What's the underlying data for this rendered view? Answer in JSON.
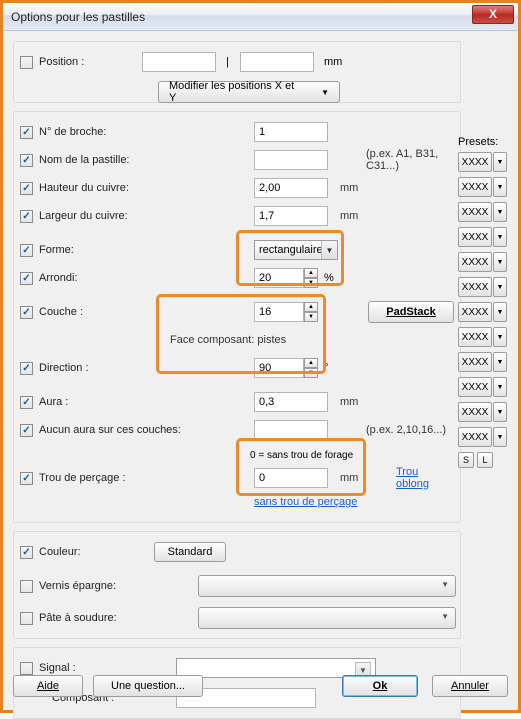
{
  "title": "Options pour les pastilles",
  "close_glyph": "X",
  "position": {
    "checkbox_label": "Position :",
    "x": "",
    "sep": "|",
    "y": "",
    "unit": "mm",
    "modify_button": "Modifier les positions X et Y"
  },
  "fields": {
    "pin_number": {
      "label": "N° de broche:",
      "value": "1"
    },
    "pad_name": {
      "label": "Nom de la pastille:",
      "value": "",
      "hint": "(p.ex. A1, B31, C31...)"
    },
    "copper_height": {
      "label": "Hauteur du cuivre:",
      "value": "2,00",
      "unit": "mm"
    },
    "copper_width": {
      "label": "Largeur du cuivre:",
      "value": "1,7",
      "unit": "mm"
    },
    "shape": {
      "label": "Forme:",
      "value": "rectangulaire"
    },
    "rounded": {
      "label": "Arrondi:",
      "value": "20",
      "unit": "%"
    },
    "layer": {
      "label": "Couche :",
      "value": "16"
    },
    "layer_note": "Face composant: pistes",
    "direction": {
      "label": "Direction :",
      "value": "90",
      "unit": "°"
    },
    "aura": {
      "label": "Aura :",
      "value": "0,3",
      "unit": "mm"
    },
    "no_aura": {
      "label": "Aucun aura sur ces couches:",
      "value": "",
      "hint": "(p.ex. 2,10,16...)"
    },
    "drill": {
      "label": "Trou de perçage :",
      "note": "0 = sans trou de forage",
      "value": "0",
      "unit": "mm",
      "link_oblong": "Trou oblong",
      "link_none": "sans trou de perçage"
    },
    "color": {
      "label": "Couleur:",
      "button": "Standard"
    },
    "soldermask": {
      "label": "Vernis épargne:"
    },
    "paste": {
      "label": "Pâte à soudure:"
    },
    "signal": {
      "label": "Signal :"
    },
    "component": {
      "label": "Composant :",
      "value": ""
    }
  },
  "padstack_button": "PadStack",
  "presets": {
    "header": "Presets:",
    "label": "XXXX",
    "count": 12,
    "s": "S",
    "l": "L"
  },
  "footer": {
    "help": "Aide",
    "question": "Une question...",
    "ok": "Ok",
    "cancel": "Annuler"
  }
}
